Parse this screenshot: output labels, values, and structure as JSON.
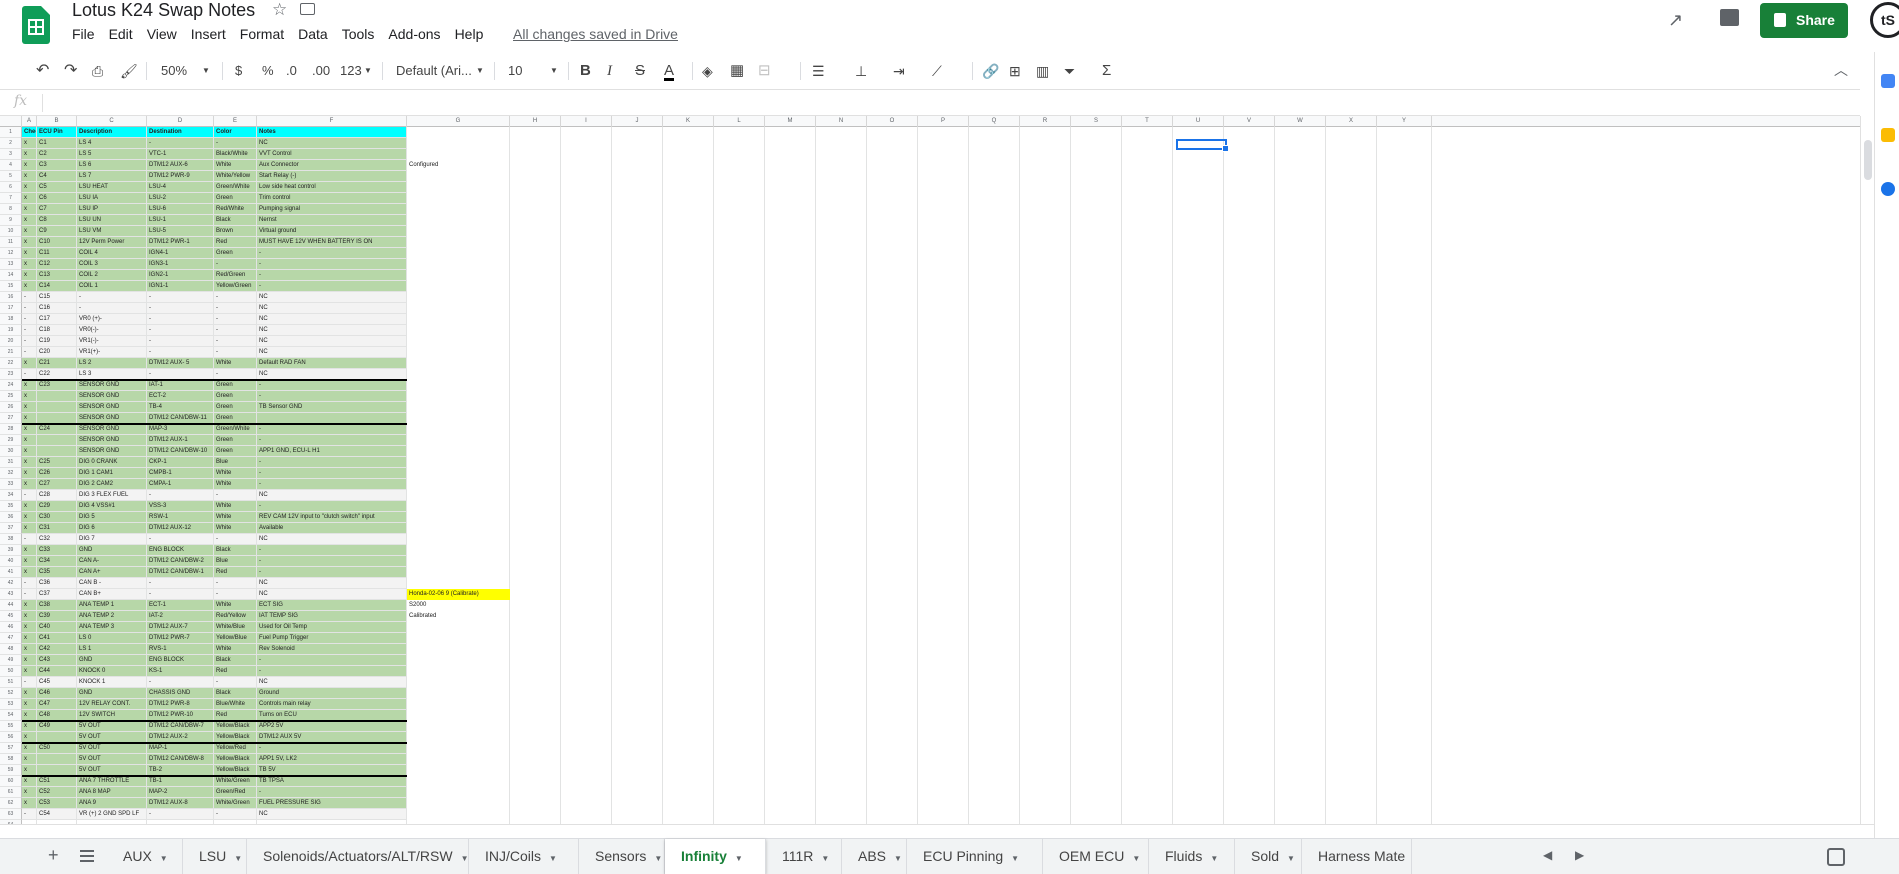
{
  "doc": {
    "title": "Lotus K24 Swap Notes",
    "saved": "All changes saved in Drive"
  },
  "menu": [
    "File",
    "Edit",
    "View",
    "Insert",
    "Format",
    "Data",
    "Tools",
    "Add-ons",
    "Help"
  ],
  "share": "Share",
  "avatar": "tS",
  "toolbar": {
    "zoom": "50%",
    "currency": "$",
    "percent": "%",
    "dec_less": ".0",
    "dec_more": ".00",
    "format": "123",
    "font": "Default (Ari...",
    "font_size": "10",
    "bold": "B",
    "italic": "I",
    "strike": "S",
    "text_color": "A",
    "functions": "Σ"
  },
  "formula_bar": {
    "fx": "fx"
  },
  "columns": [
    "A",
    "B",
    "C",
    "D",
    "E",
    "F",
    "G",
    "H",
    "I",
    "J",
    "K",
    "L",
    "M",
    "N",
    "O",
    "P",
    "Q",
    "R",
    "S",
    "T",
    "U",
    "V",
    "W",
    "X",
    "Y"
  ],
  "header": [
    "Check",
    "ECU Pin",
    "Description",
    "Destination",
    "Color",
    "Notes"
  ],
  "rows": [
    [
      "x",
      "C1",
      "LS 4",
      "-",
      "-",
      "NC"
    ],
    [
      "x",
      "C2",
      "LS 5",
      "VTC-1",
      "Black/White",
      "VVT Control"
    ],
    [
      "x",
      "C3",
      "LS 6",
      "DTM12 AUX-6",
      "White",
      "Aux Connector"
    ],
    [
      "x",
      "C4",
      "LS 7",
      "DTM12 PWR-9",
      "White/Yellow",
      "Start Relay (-)"
    ],
    [
      "x",
      "C5",
      "LSU HEAT",
      "LSU-4",
      "Green/White",
      "Low side heat control"
    ],
    [
      "x",
      "C6",
      "LSU IA",
      "LSU-2",
      "Green",
      "Trim control"
    ],
    [
      "x",
      "C7",
      "LSU IP",
      "LSU-6",
      "Red/White",
      "Pumping signal"
    ],
    [
      "x",
      "C8",
      "LSU UN",
      "LSU-1",
      "Black",
      "Nernst"
    ],
    [
      "x",
      "C9",
      "LSU VM",
      "LSU-5",
      "Brown",
      "Virtual ground"
    ],
    [
      "x",
      "C10",
      "12V Perm Power",
      "DTM12 PWR-1",
      "Red",
      "MUST HAVE 12V WHEN BATTERY IS ON"
    ],
    [
      "x",
      "C11",
      "COIL 4",
      "IGN4-1",
      "Green",
      "-"
    ],
    [
      "x",
      "C12",
      "COIL 3",
      "IGN3-1",
      "-",
      "-"
    ],
    [
      "x",
      "C13",
      "COIL 2",
      "IGN2-1",
      "Red/Green",
      "-"
    ],
    [
      "x",
      "C14",
      "COIL 1",
      "IGN1-1",
      "Yellow/Green",
      "-"
    ],
    [
      "-",
      "C15",
      "-",
      "-",
      "-",
      "NC"
    ],
    [
      "-",
      "C16",
      "-",
      "-",
      "-",
      "NC"
    ],
    [
      "-",
      "C17",
      "VR0 (+)-",
      "-",
      "-",
      "NC"
    ],
    [
      "-",
      "C18",
      "VR0(-)-",
      "-",
      "-",
      "NC"
    ],
    [
      "-",
      "C19",
      "VR1(-)-",
      "-",
      "-",
      "NC"
    ],
    [
      "-",
      "C20",
      "VR1(+)-",
      "-",
      "-",
      "NC"
    ],
    [
      "x",
      "C21",
      "LS 2",
      "DTM12 AUX- 5",
      "White",
      "Default RAD FAN"
    ],
    [
      "-",
      "C22",
      "LS 3",
      "-",
      "-",
      "NC"
    ],
    [
      "x",
      "C23",
      "SENSOR GND",
      "IAT-1",
      "Green",
      "-"
    ],
    [
      "x",
      "",
      "SENSOR GND",
      "ECT-2",
      "Green",
      "-"
    ],
    [
      "x",
      "",
      "SENSOR GND",
      "TB-4",
      "Green",
      "TB Sensor GND"
    ],
    [
      "x",
      "",
      "SENSOR GND",
      "DTM12 CAN/DBW-11",
      "Green",
      ""
    ],
    [
      "x",
      "C24",
      "SENSOR GND",
      "MAP-3",
      "Green/White",
      "-"
    ],
    [
      "x",
      "",
      "SENSOR GND",
      "DTM12 AUX-1",
      "Green",
      "-"
    ],
    [
      "x",
      "",
      "SENSOR GND",
      "DTM12 CAN/DBW-10",
      "Green",
      "APP1 GND, ECU-L H1"
    ],
    [
      "x",
      "C25",
      "DIG 0 CRANK",
      "CKP-1",
      "Blue",
      "-"
    ],
    [
      "x",
      "C26",
      "DIG 1 CAM1",
      "CMPB-1",
      "White",
      "-"
    ],
    [
      "x",
      "C27",
      "DIG 2 CAM2",
      "CMPA-1",
      "White",
      "-"
    ],
    [
      "-",
      "C28",
      "DIG 3 FLEX FUEL",
      "-",
      "-",
      "NC"
    ],
    [
      "x",
      "C29",
      "DIG 4 VSS#1",
      "VSS-3",
      "White",
      "-"
    ],
    [
      "x",
      "C30",
      "DIG 5",
      "RSW-1",
      "White",
      "REV CAM 12V input to \"clutch switch\" input"
    ],
    [
      "x",
      "C31",
      "DIG 6",
      "DTM12 AUX-12",
      "White",
      "Available"
    ],
    [
      "-",
      "C32",
      "DIG 7",
      "-",
      "-",
      "NC"
    ],
    [
      "x",
      "C33",
      "GND",
      "ENG BLOCK",
      "Black",
      "-"
    ],
    [
      "x",
      "C34",
      "CAN A-",
      "DTM12 CAN/DBW-2",
      "Blue",
      "-"
    ],
    [
      "x",
      "C35",
      "CAN A+",
      "DTM12 CAN/DBW-1",
      "Red",
      "-"
    ],
    [
      "-",
      "C36",
      "CAN B -",
      "-",
      "-",
      "NC"
    ],
    [
      "-",
      "C37",
      "CAN B+",
      "-",
      "-",
      "NC"
    ],
    [
      "x",
      "C38",
      "ANA TEMP 1",
      "ECT-1",
      "White",
      "ECT SIG"
    ],
    [
      "x",
      "C39",
      "ANA TEMP 2",
      "IAT-2",
      "Red/Yellow",
      "IAT TEMP SIG"
    ],
    [
      "x",
      "C40",
      "ANA TEMP 3",
      "DTM12 AUX-7",
      "White/Blue",
      "Used for Oil Temp"
    ],
    [
      "x",
      "C41",
      "LS 0",
      "DTM12 PWR-7",
      "Yellow/Blue",
      "Fuel Pump Trigger"
    ],
    [
      "x",
      "C42",
      "LS 1",
      "RVS-1",
      "White",
      "Rev Solenoid"
    ],
    [
      "x",
      "C43",
      "GND",
      "ENG BLOCK",
      "Black",
      "-"
    ],
    [
      "x",
      "C44",
      "KNOCK 0",
      "KS-1",
      "Red",
      "-"
    ],
    [
      "-",
      "C45",
      "KNOCK 1",
      "-",
      "-",
      "NC"
    ],
    [
      "x",
      "C46",
      "GND",
      "CHASSIS GND",
      "Black",
      "Ground"
    ],
    [
      "x",
      "C47",
      "12V RELAY CONT.",
      "DTM12 PWR-8",
      "Blue/White",
      "Controls main relay"
    ],
    [
      "x",
      "C48",
      "12V SWITCH",
      "DTM12 PWR-10",
      "Red",
      "Turns on ECU"
    ],
    [
      "x",
      "C49",
      "5V OUT",
      "DTM12 CAN/DBW-7",
      "Yellow/Black",
      "APP2 5V"
    ],
    [
      "x",
      "",
      "5V OUT",
      "DTM12 AUX-2",
      "Yellow/Black",
      "DTM12 AUX 5V"
    ],
    [
      "x",
      "C50",
      "5V OUT",
      "MAP-1",
      "Yellow/Red",
      "-"
    ],
    [
      "x",
      "",
      "5V OUT",
      "DTM12 CAN/DBW-8",
      "Yellow/Black",
      "APP1 5V, LK2"
    ],
    [
      "x",
      "",
      "5V OUT",
      "TB-2",
      "Yellow/Black",
      "TB 5V"
    ],
    [
      "x",
      "C51",
      "ANA 7 THROTTLE",
      "TB-1",
      "White/Green",
      "TB TPSA"
    ],
    [
      "x",
      "C52",
      "ANA 8 MAP",
      "MAP-2",
      "Green/Red",
      "-"
    ],
    [
      "x",
      "C53",
      "ANA 9",
      "DTM12 AUX-8",
      "White/Green",
      "FUEL PRESSURE SIG"
    ],
    [
      "-",
      "C54",
      "VR (+) 2 GND SPD LF",
      "-",
      "-",
      "NC"
    ]
  ],
  "side_notes": [
    {
      "row": 3,
      "text": "Configured",
      "yellow": false
    },
    {
      "row": 42,
      "text": "Honda-02-06 9 (Calibrate)",
      "yellow": true
    },
    {
      "row": 43,
      "text": "S2000",
      "yellow": false
    },
    {
      "row": 44,
      "text": "Calibrated",
      "yellow": false
    }
  ],
  "tabs": [
    {
      "label": "AUX",
      "active": false
    },
    {
      "label": "LSU",
      "active": false
    },
    {
      "label": "Solenoids/Actuators/ALT/RSW",
      "active": false
    },
    {
      "label": "INJ/Coils",
      "active": false
    },
    {
      "label": "Sensors",
      "active": false
    },
    {
      "label": "Infinity",
      "active": true
    },
    {
      "label": "111R",
      "active": false
    },
    {
      "label": "ABS",
      "active": false
    },
    {
      "label": "ECU Pinning",
      "active": false
    },
    {
      "label": "OEM ECU",
      "active": false
    },
    {
      "label": "Fluids",
      "active": false
    },
    {
      "label": "Sold",
      "active": false
    },
    {
      "label": "Harness Mate",
      "active": false
    }
  ],
  "colors": {
    "green_fill": "#b7d7a8",
    "header_fill": "#00ffff",
    "brand": "#188038",
    "highlight": "#ffff00"
  }
}
